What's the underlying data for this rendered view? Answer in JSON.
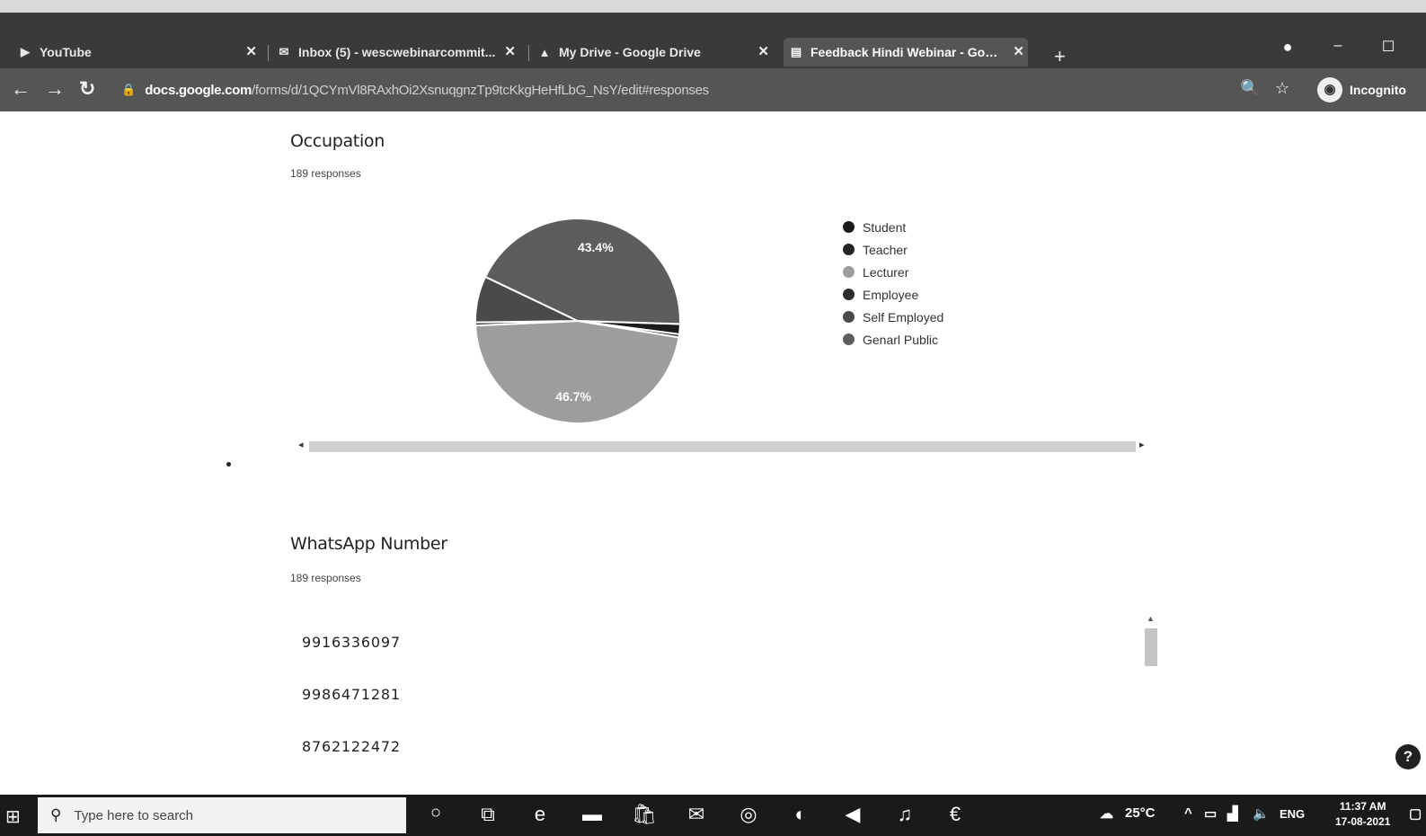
{
  "browser": {
    "tabs": [
      {
        "title": "YouTube",
        "favicon": "youtube-icon"
      },
      {
        "title": "Inbox (5) - wescwebinarcommit...",
        "favicon": "mail-icon"
      },
      {
        "title": "My Drive - Google Drive",
        "favicon": "drive-icon"
      },
      {
        "title": "Feedback Hindi Webinar - Goog",
        "favicon": "forms-icon",
        "active": true
      }
    ],
    "url_domain": "docs.google.com",
    "url_path": "/forms/d/1QCYmVl8RAxhOi2XsnuqgnzTp9tcKkgHeHfLbG_NsY/edit#responses",
    "profile_label": "Incognito"
  },
  "occupation": {
    "title": "Occupation",
    "responses": "189 responses",
    "chart_data": {
      "type": "pie",
      "labels": [
        "Student",
        "Teacher",
        "Lecturer",
        "Employee",
        "Self Employed",
        "Genarl Public"
      ],
      "values": [
        1.6,
        0.5,
        46.7,
        0.5,
        7.3,
        43.4
      ],
      "slice_labels": [
        "",
        "",
        "46.7%",
        "",
        "",
        "43.4%"
      ],
      "colors": [
        "#1c1c1c",
        "#252525",
        "#9d9d9d",
        "#2c2c2c",
        "#4a4a4a",
        "#5d5d5d"
      ],
      "legend_position": "right"
    }
  },
  "whatsapp": {
    "title": "WhatsApp Number",
    "responses": "189 responses",
    "answers": [
      "9916336097",
      "9986471281",
      "8762122472"
    ]
  },
  "taskbar": {
    "search_placeholder": "Type here to search",
    "weather": "25°C",
    "language": "ENG",
    "time": "11:37 AM",
    "date": "17-08-2021"
  }
}
